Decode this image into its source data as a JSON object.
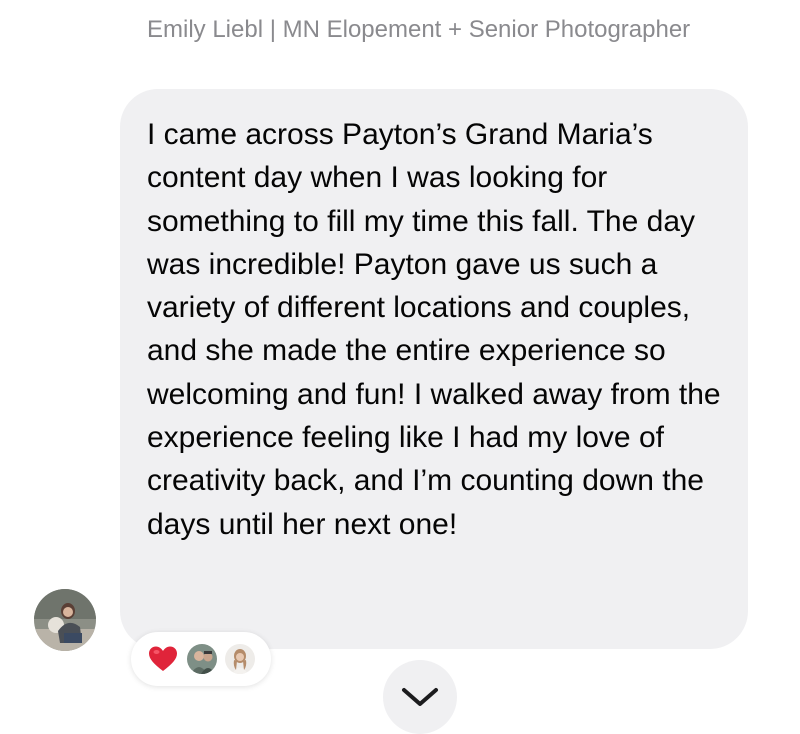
{
  "message": {
    "sender_name": "Emily Liebl | MN Elopement + Senior Photographer",
    "text": "I came across Payton’s Grand Maria’s content day when I was looking for something to fill my time this fall. The day was incredible! Payton gave us such a variety of different locations and couples, and she made the entire experience so welcoming and fun! I walked away from the experience feeling like I had my love of creativity back, and I’m counting down the days until her next one!",
    "bubble_color": "#f0f0f2",
    "text_color": "#050505",
    "name_color": "#8a8a8e"
  },
  "reactions": {
    "emoji_icon": "red-heart-icon",
    "reactor_count_shown": 2,
    "heart_color": "#e0243a"
  },
  "controls": {
    "scroll_icon": "chevron-down-icon"
  }
}
